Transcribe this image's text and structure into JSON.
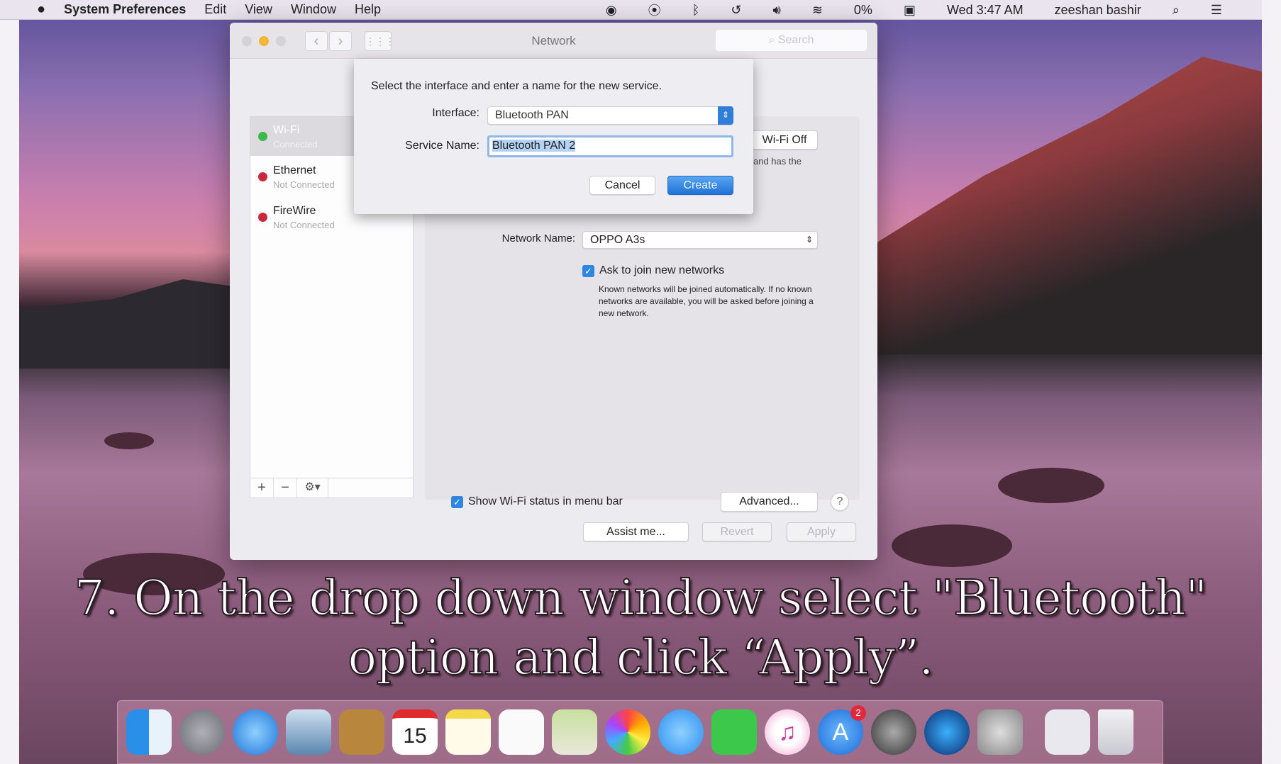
{
  "menubar": {
    "app": "System Preferences",
    "items": [
      "Edit",
      "View",
      "Window",
      "Help"
    ],
    "battery": "0%",
    "clock": "Wed 3:47 AM",
    "user": "zeeshan bashir"
  },
  "window": {
    "title": "Network",
    "search_placeholder": "Search"
  },
  "sidebar": {
    "items": [
      {
        "name": "Wi-Fi",
        "status": "Connected",
        "color": "#3cb94a"
      },
      {
        "name": "Ethernet",
        "status": "Not Connected",
        "color": "#c8283c"
      },
      {
        "name": "FireWire",
        "status": "Not Connected",
        "color": "#c8283c"
      }
    ],
    "add": "+",
    "remove": "−",
    "gear": "⚙▾"
  },
  "panel": {
    "wifi_off": "Wi-Fi Off",
    "status_fragment": "and has the",
    "network_name_label": "Network Name:",
    "network_name": "OPPO A3s",
    "ask_join_label": "Ask to join new networks",
    "ask_join_checked": true,
    "ask_join_help": "Known networks will be joined automatically. If no known networks are available, you will be asked before joining a new network.",
    "show_status_label": "Show Wi-Fi status in menu bar",
    "show_status_checked": true,
    "advanced": "Advanced...",
    "help": "?"
  },
  "footer": {
    "assist": "Assist me...",
    "revert": "Revert",
    "apply": "Apply"
  },
  "sheet": {
    "prompt": "Select the interface and enter a name for the new service.",
    "interface_label": "Interface:",
    "interface_value": "Bluetooth PAN",
    "service_label": "Service Name:",
    "service_value": "Bluetooth PAN 2",
    "cancel": "Cancel",
    "create": "Create"
  },
  "caption": {
    "line1": "7. On the drop down window select \"Bluetooth\"",
    "line2": "option and click “Apply”."
  },
  "dock": {
    "apps": [
      "finder",
      "launchpad",
      "safari",
      "mail",
      "contacts",
      "calendar",
      "notes",
      "reminders",
      "preview",
      "photos",
      "messages",
      "facetime",
      "itunes",
      "app-store",
      "system-preferences",
      "quicktime",
      "automator",
      "keyboard-viewer",
      "trash"
    ],
    "calendar_day": "15",
    "app_store_badge": "2"
  }
}
